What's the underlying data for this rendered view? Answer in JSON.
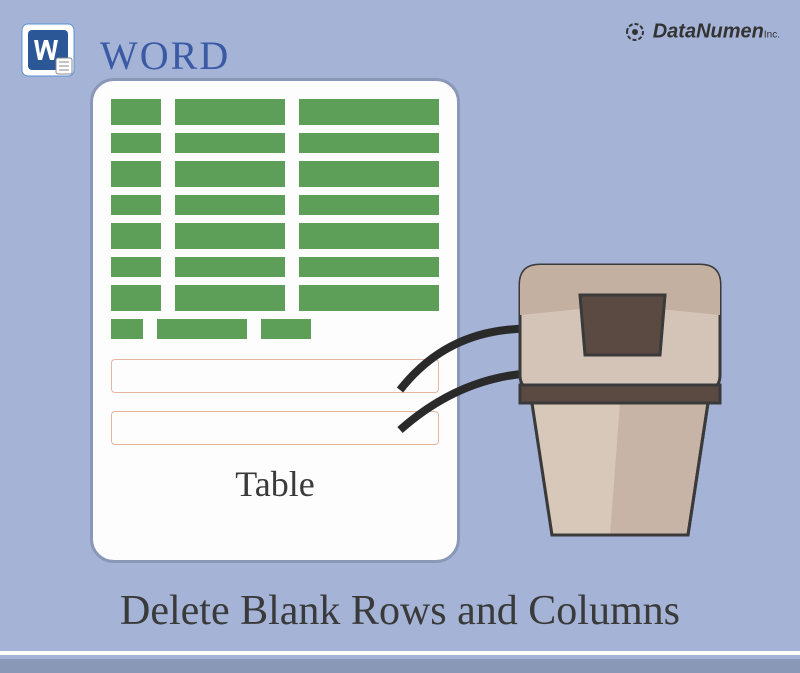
{
  "header": {
    "product_label": "WORD",
    "brand": "DataNumen",
    "brand_suffix": "Inc."
  },
  "document": {
    "table_label": "Table"
  },
  "title": "Delete Blank Rows and Columns",
  "colors": {
    "background": "#a4b3d6",
    "accent_blue": "#3a5aa6",
    "cell_green": "#5d9e58",
    "blank_border": "#e4b5a0",
    "panel_border": "#8a98b8"
  }
}
